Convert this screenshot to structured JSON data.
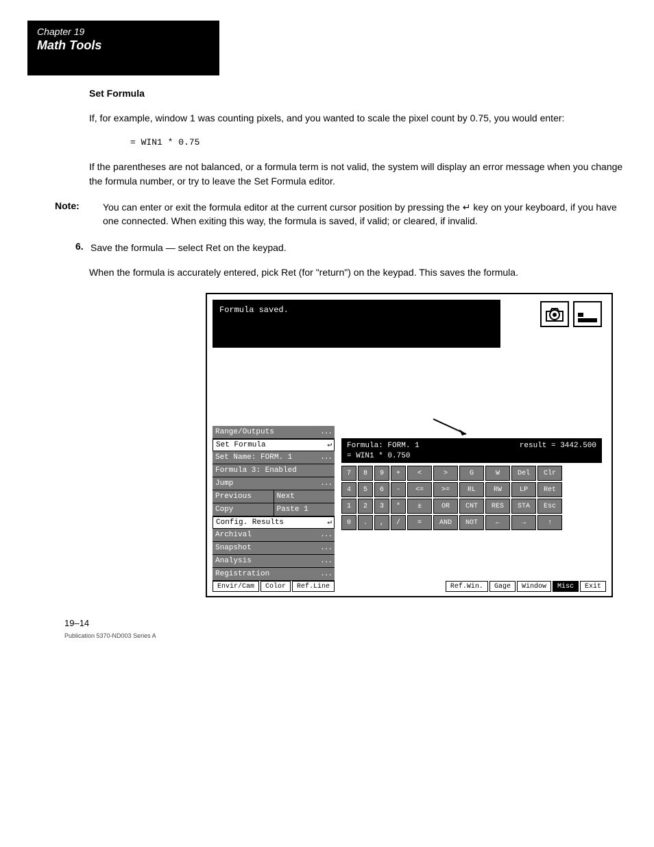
{
  "chapter": {
    "num": "Chapter 19",
    "title": "Math Tools"
  },
  "paragraphs": {
    "p1": "If, for example, window 1 was counting pixels, and you wanted to scale the pixel count by 0.75, you would enter:",
    "p2": "If the parentheses are not balanced, or a formula term is not valid, the system will display an error message when you change the formula number, or try to leave the Set Formula editor.",
    "p3": "When the formula is accurately entered, pick Ret (for \"return\") on the keypad. This saves the formula.",
    "formula_line": "= WIN1 * 0.75"
  },
  "labels": {
    "set_formula": "Set Formula",
    "note": "Note:"
  },
  "step": {
    "num": "6.",
    "text": "Save the formula — select Ret on the keypad."
  },
  "note_text": "You can enter or exit the formula editor at the current cursor position by pressing the ↵ key on your keyboard, if you have one connected. When exiting this way, the formula is saved, if valid; or cleared, if invalid.",
  "screenshot": {
    "message": "Formula saved.",
    "formula_title": "Formula: FORM. 1",
    "result_label": "result = 3442.500",
    "formula_body": "= WIN1 * 0.750",
    "menu": [
      {
        "label": "Range/Outputs",
        "suffix": "...",
        "sel": false
      },
      {
        "label": "Set Formula",
        "suffix": "↵",
        "sel": true
      },
      {
        "label": "Set Name: FORM. 1",
        "suffix": "...",
        "sel": false
      },
      {
        "label": "Formula 3: Enabled",
        "suffix": "",
        "sel": false
      },
      {
        "label": "Jump",
        "suffix": "...",
        "sel": false
      }
    ],
    "menu_split": {
      "left": "Previous",
      "right": "Next"
    },
    "menu_split2": {
      "left": "Copy",
      "right": "Paste 1"
    },
    "menu2": [
      {
        "label": "Config. Results",
        "suffix": "↵",
        "sel": true
      },
      {
        "label": "Archival",
        "suffix": "...",
        "sel": false
      },
      {
        "label": "Snapshot",
        "suffix": "...",
        "sel": false
      },
      {
        "label": "Analysis",
        "suffix": "...",
        "sel": false
      },
      {
        "label": "Registration",
        "suffix": "...",
        "sel": false
      }
    ],
    "keys": [
      [
        "7",
        "8",
        "9",
        "+",
        "<",
        ">",
        "G",
        "W",
        "Del",
        "Clr"
      ],
      [
        "4",
        "5",
        "6",
        "-",
        "<=",
        ">=",
        "RL",
        "RW",
        "LP",
        "Ret"
      ],
      [
        "1",
        "2",
        "3",
        "*",
        "±",
        "OR",
        "CNT",
        "RES",
        "STA",
        "Esc"
      ],
      [
        "0",
        ".",
        ",",
        "/",
        "=",
        "AND",
        "NOT",
        "←",
        "→",
        "↑"
      ]
    ],
    "tabs": [
      "Envir/Cam",
      "Color",
      "Ref.Line",
      "Ref.Win.",
      "Gage",
      "Window",
      "Misc",
      "Exit"
    ],
    "active_tab": "Misc"
  },
  "page_number": "19–14",
  "footer": "Publication 5370-ND003 Series A"
}
